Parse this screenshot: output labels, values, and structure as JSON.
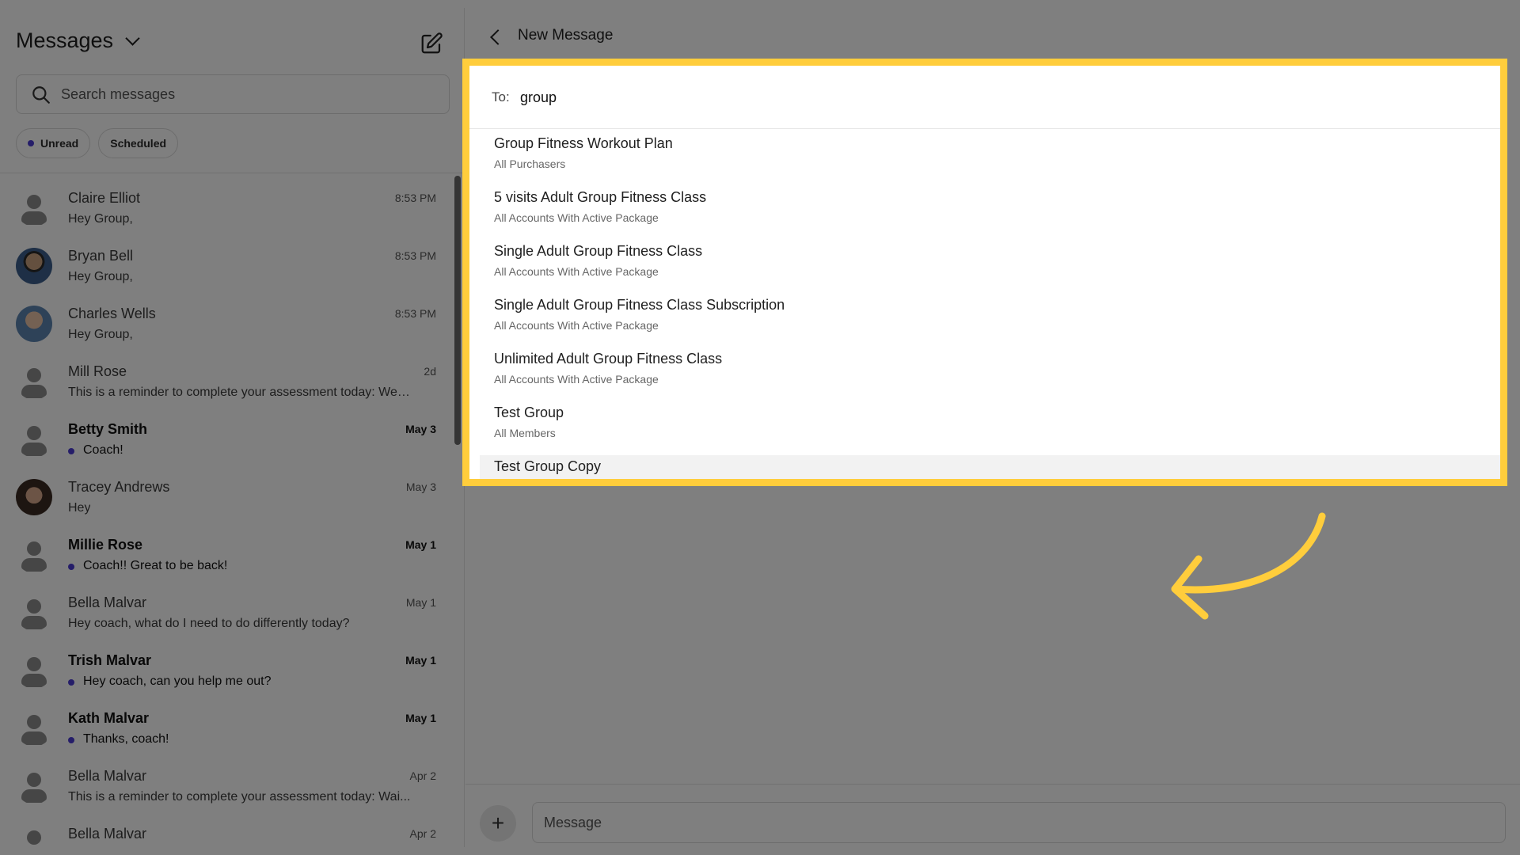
{
  "sidebar": {
    "title": "Messages",
    "search": {
      "placeholder": "Search messages"
    },
    "filters": [
      {
        "label": "Unread",
        "dot": true
      },
      {
        "label": "Scheduled",
        "dot": false
      }
    ],
    "conversations": [
      {
        "name": "Claire Elliot",
        "time": "8:53 PM",
        "preview": "Hey Group,",
        "unread": false,
        "avatar": "placeholder"
      },
      {
        "name": "Bryan Bell",
        "time": "8:53 PM",
        "preview": "Hey Group,",
        "unread": false,
        "avatar": "photo1"
      },
      {
        "name": "Charles Wells",
        "time": "8:53 PM",
        "preview": "Hey Group,",
        "unread": false,
        "avatar": "photo2"
      },
      {
        "name": "Mill Rose",
        "time": "2d",
        "preview": "This is a reminder to complete your assessment today: Week...",
        "unread": false,
        "avatar": "placeholder"
      },
      {
        "name": "Betty Smith",
        "time": "May 3",
        "preview": "Coach!",
        "unread": true,
        "avatar": "placeholder"
      },
      {
        "name": "Tracey Andrews",
        "time": "May 3",
        "preview": "Hey",
        "unread": false,
        "avatar": "photo3"
      },
      {
        "name": "Millie Rose",
        "time": "May 1",
        "preview": "Coach!! Great to be back!",
        "unread": true,
        "avatar": "placeholder"
      },
      {
        "name": "Bella Malvar",
        "time": "May 1",
        "preview": "Hey coach, what do I need to do differently today?",
        "unread": false,
        "avatar": "placeholder"
      },
      {
        "name": "Trish Malvar",
        "time": "May 1",
        "preview": "Hey coach, can you help me out?",
        "unread": true,
        "avatar": "placeholder"
      },
      {
        "name": "Kath Malvar",
        "time": "May 1",
        "preview": "Thanks, coach!",
        "unread": true,
        "avatar": "placeholder"
      },
      {
        "name": "Bella Malvar",
        "time": "Apr 2",
        "preview": "This is a reminder to complete your assessment today: Wai...",
        "unread": false,
        "avatar": "placeholder"
      },
      {
        "name": "Bella Malvar",
        "time": "Apr 2",
        "preview": "",
        "unread": false,
        "avatar": "placeholder"
      }
    ]
  },
  "main": {
    "title": "New Message",
    "to_label": "To:",
    "to_value": "group",
    "suggestions": [
      {
        "title": "Group Fitness Workout Plan",
        "subtitle": "All Purchasers"
      },
      {
        "title": "5 visits Adult Group Fitness Class",
        "subtitle": "All Accounts With Active Package"
      },
      {
        "title": "Single Adult Group Fitness Class",
        "subtitle": "All Accounts With Active Package"
      },
      {
        "title": "Single Adult Group Fitness Class Subscription",
        "subtitle": "All Accounts With Active Package"
      },
      {
        "title": "Unlimited Adult Group Fitness Class",
        "subtitle": "All Accounts With Active Package"
      },
      {
        "title": "Test Group",
        "subtitle": "All Members"
      },
      {
        "title": "Test Group Copy",
        "subtitle": ""
      }
    ],
    "compose": {
      "placeholder": "Message",
      "plus": "+"
    }
  },
  "colors": {
    "highlight": "#ffcd3c",
    "unread_dot": "#4b3bd3"
  }
}
